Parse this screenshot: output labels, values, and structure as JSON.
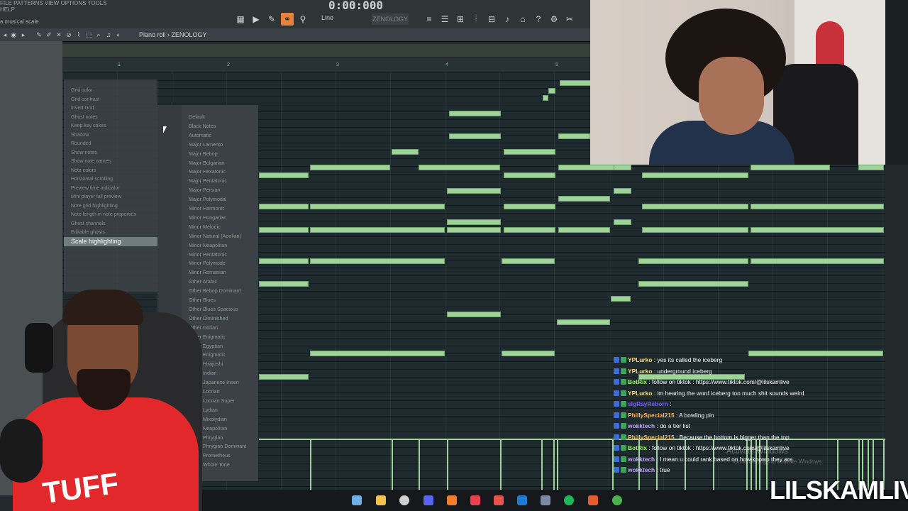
{
  "app": {
    "menu_text": "FILE PATTERNS VIEW OPTIONS TOOLS HELP",
    "time_display": "0:00:000",
    "snap_label": "Line",
    "preset_name": "ZENOLOGY",
    "hint_text": "a musical scale",
    "piano_roll_title": "Piano roll › ZENOLOGY",
    "ruler_numbers": [
      "1",
      "2",
      "3",
      "4",
      "5"
    ]
  },
  "view_menu": {
    "items": [
      "Grid color",
      "Grid contrast",
      "Invert Grid",
      "Ghost notes",
      "Keep key colors",
      "Shadow",
      "Rounded",
      "Show notes",
      "Show note names",
      "Note colors",
      "Horizontal scrolling",
      "Preview time indicator",
      "Mini player tall preview",
      "Note grid highlighting",
      "Note length in note properties",
      "Ghost channels",
      "Editable ghosts"
    ],
    "highlighted": "Scale highlighting"
  },
  "scale_menu": {
    "items": [
      "Default",
      "Black Notes",
      "Automatic",
      "Major Lamento",
      "Major Bebop",
      "Major Bulgarian",
      "Major Hexatonic",
      "Major Pentatonic",
      "Major Persian",
      "Major Polymodal",
      "Minor Harmonic",
      "Minor Hungarian",
      "Minor Melodic",
      "Minor Natural (Aeolian)",
      "Minor Neapolitan",
      "Minor Pentatonic",
      "Minor Polymode",
      "Minor Romanian",
      "Other Arabic",
      "Other Bebop Dominant",
      "Other Blues",
      "Other Blues Spacious",
      "Other Diminished",
      "Other Dorian",
      "Other Enigmatic",
      "Other Egyptian",
      "Other Enigmatic",
      "Other Hirajoshi",
      "Other Indian",
      "Other Japanese Insen",
      "Other Locrian",
      "Other Locrian Super",
      "Other Lydian",
      "Other Mixolydian",
      "Other Neapolitan",
      "Other Phrygian",
      "Other Phrygian Dominant",
      "Other Prometheus",
      "Other Whole Tone"
    ]
  },
  "chat": [
    {
      "user": "YPLurko",
      "text": " : yes its called the iceberg",
      "color": "#ffe066"
    },
    {
      "user": "YPLurko",
      "text": " : underground iceberg",
      "color": "#ffe066"
    },
    {
      "user": "BotRix",
      "text": " : follow on tiktok : https://www.tiktok.com/@lilskamlive",
      "color": "#9eff5a"
    },
    {
      "user": "YPLurko",
      "text": " : im hearing the word iceberg too much shit sounds weird",
      "color": "#ffe066"
    },
    {
      "user": "slgRayReborn",
      "text": " : ",
      "color": "#7a5aff"
    },
    {
      "user": "PhillySpecial215",
      "text": " : A bowling pin",
      "color": "#ffb84d"
    },
    {
      "user": "wokktech",
      "text": " : do a tier list",
      "color": "#bfa6ff"
    },
    {
      "user": "PhillySpecial215",
      "text": " : Because the bottom is bigger than the top",
      "color": "#ffb84d"
    },
    {
      "user": "BotRix",
      "text": " : follow on tiktok : https://www.tiktok.com/@lilskamlive",
      "color": "#9eff5a"
    },
    {
      "user": "wokktech",
      "text": " : I mean u could rank based on how known they are",
      "color": "#bfa6ff"
    },
    {
      "user": "wokktech",
      "text": " : true",
      "color": "#bfa6ff"
    }
  ],
  "watermark": {
    "line1": "Activate Windows",
    "line2": "Go to Settings to activate Windows."
  },
  "brand": "LILSKAMLIVE",
  "shirt_text": "TUFF",
  "accent_note_color": "#9ed49a"
}
